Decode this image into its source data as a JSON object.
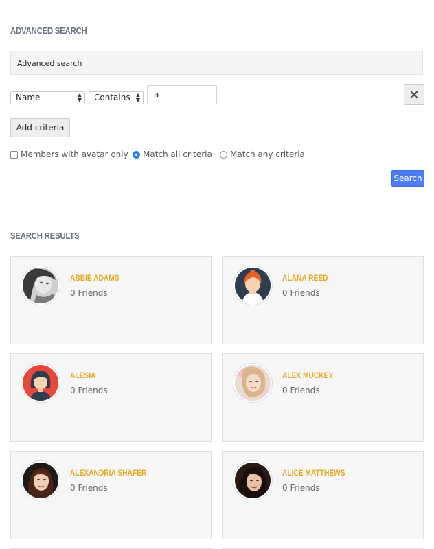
{
  "advanced_search": {
    "title": "ADVANCED SEARCH",
    "panel_label": "Advanced search",
    "criteria": {
      "field_select": "Name",
      "operator_select": "Contains",
      "value": "a"
    },
    "remove_icon": "close-icon",
    "add_criteria_label": "Add criteria",
    "options": {
      "avatar_only_label": "Members with avatar only",
      "avatar_only_checked": false,
      "match_all_label": "Match all criteria",
      "match_any_label": "Match any criteria",
      "selected_match": "all"
    },
    "search_button_label": "Search"
  },
  "search_results": {
    "title": "SEARCH RESULTS",
    "members": [
      {
        "name": "ABBIE ADAMS",
        "friends": "0 Friends",
        "avatar": "photo-grayscale"
      },
      {
        "name": "ALANA REED",
        "friends": "0 Friends",
        "avatar": "illustration-redhead"
      },
      {
        "name": "ALESIA",
        "friends": "0 Friends",
        "avatar": "illustration-dark-hair"
      },
      {
        "name": "ALEX MUCKEY",
        "friends": "0 Friends",
        "avatar": "photo-light"
      },
      {
        "name": "ALEXANDRIA SHAFER",
        "friends": "0 Friends",
        "avatar": "photo-dark"
      },
      {
        "name": "ALICE MATTHEWS",
        "friends": "0 Friends",
        "avatar": "photo-dark"
      }
    ]
  },
  "colors": {
    "accent_name": "#e5a822",
    "primary_button": "#4d7cf5",
    "radio_selected": "#2f80ed"
  }
}
